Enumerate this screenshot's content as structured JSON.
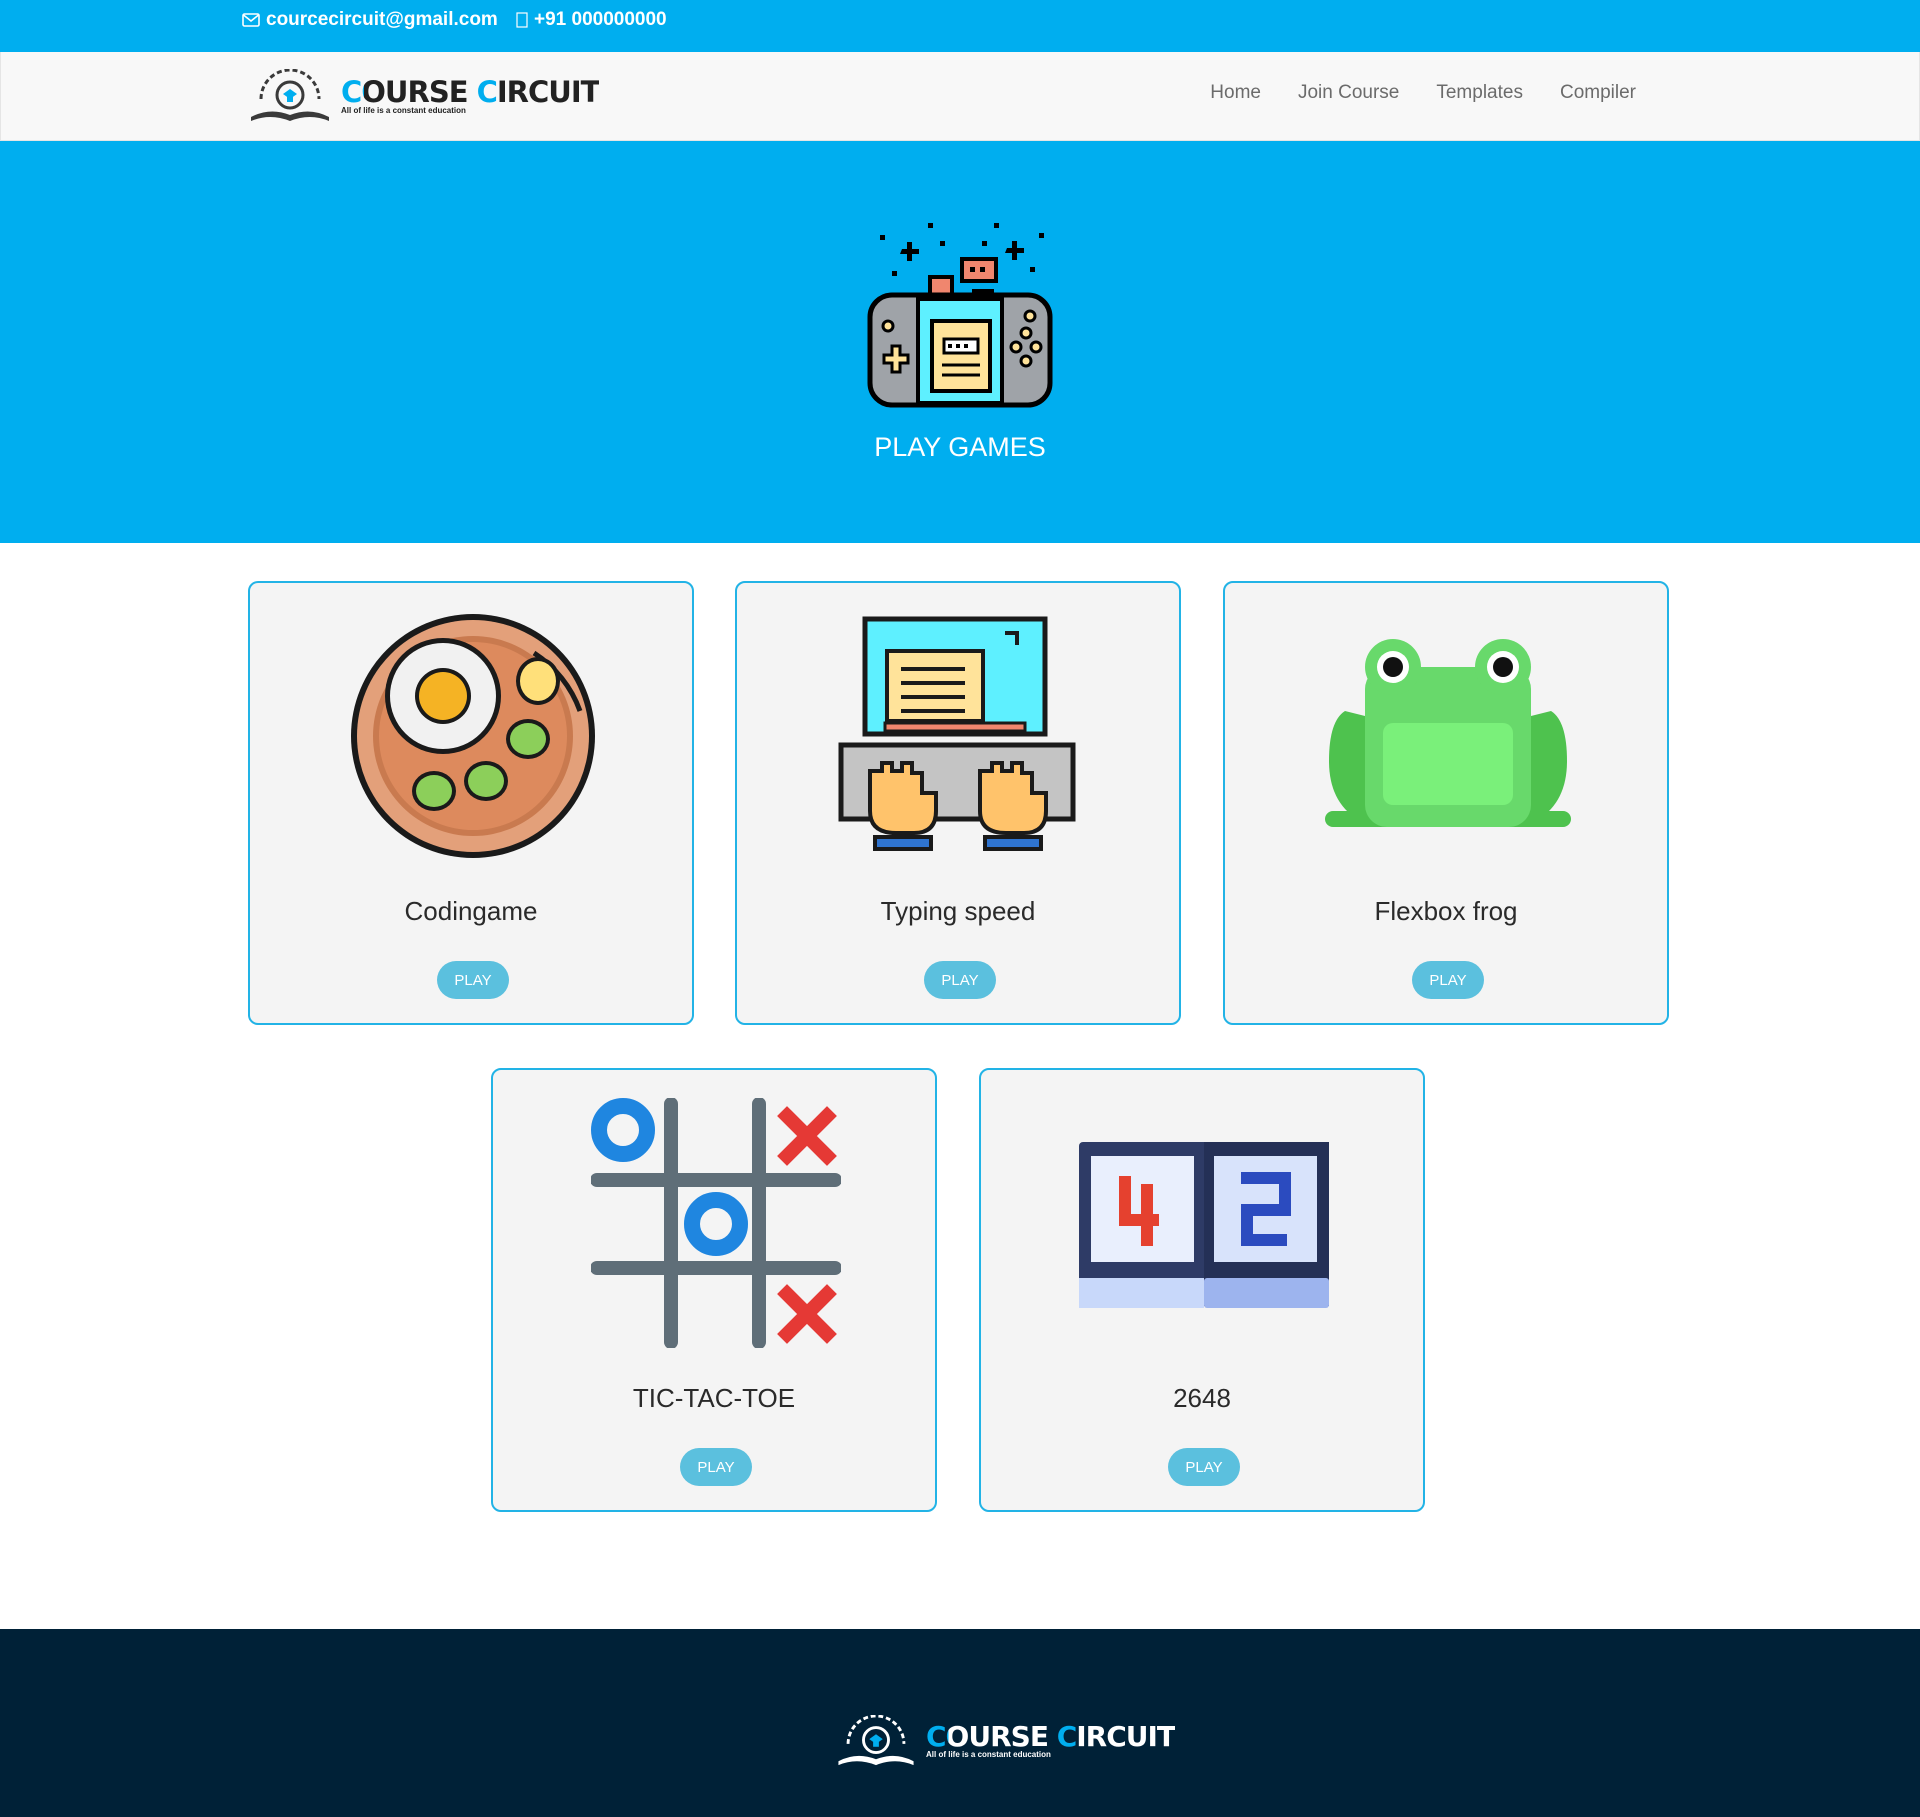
{
  "topbar": {
    "email": "courcecircuit@gmail.com",
    "phone": "+91 000000000"
  },
  "brand": {
    "name": "Course Circuit",
    "tagline": "All of life is a constant education"
  },
  "nav": {
    "items": [
      {
        "label": "Home"
      },
      {
        "label": "Join Course"
      },
      {
        "label": "Templates"
      },
      {
        "label": "Compiler"
      }
    ]
  },
  "hero": {
    "title": "PLAY GAMES",
    "icon": "handheld-console-icon"
  },
  "games": [
    {
      "title": "Codingame",
      "button": "PLAY",
      "icon": "food-plate-icon"
    },
    {
      "title": "Typing speed",
      "button": "PLAY",
      "icon": "typing-computer-icon"
    },
    {
      "title": "Flexbox frog",
      "button": "PLAY",
      "icon": "frog-icon"
    },
    {
      "title": "TIC-TAC-TOE",
      "button": "PLAY",
      "icon": "tic-tac-toe-icon"
    },
    {
      "title": "2648",
      "button": "PLAY",
      "icon": "scoreboard-icon"
    }
  ],
  "colors": {
    "primary": "#00aeef",
    "button": "#5bc0de",
    "footer": "#002137",
    "card_bg": "#f4f4f4"
  }
}
